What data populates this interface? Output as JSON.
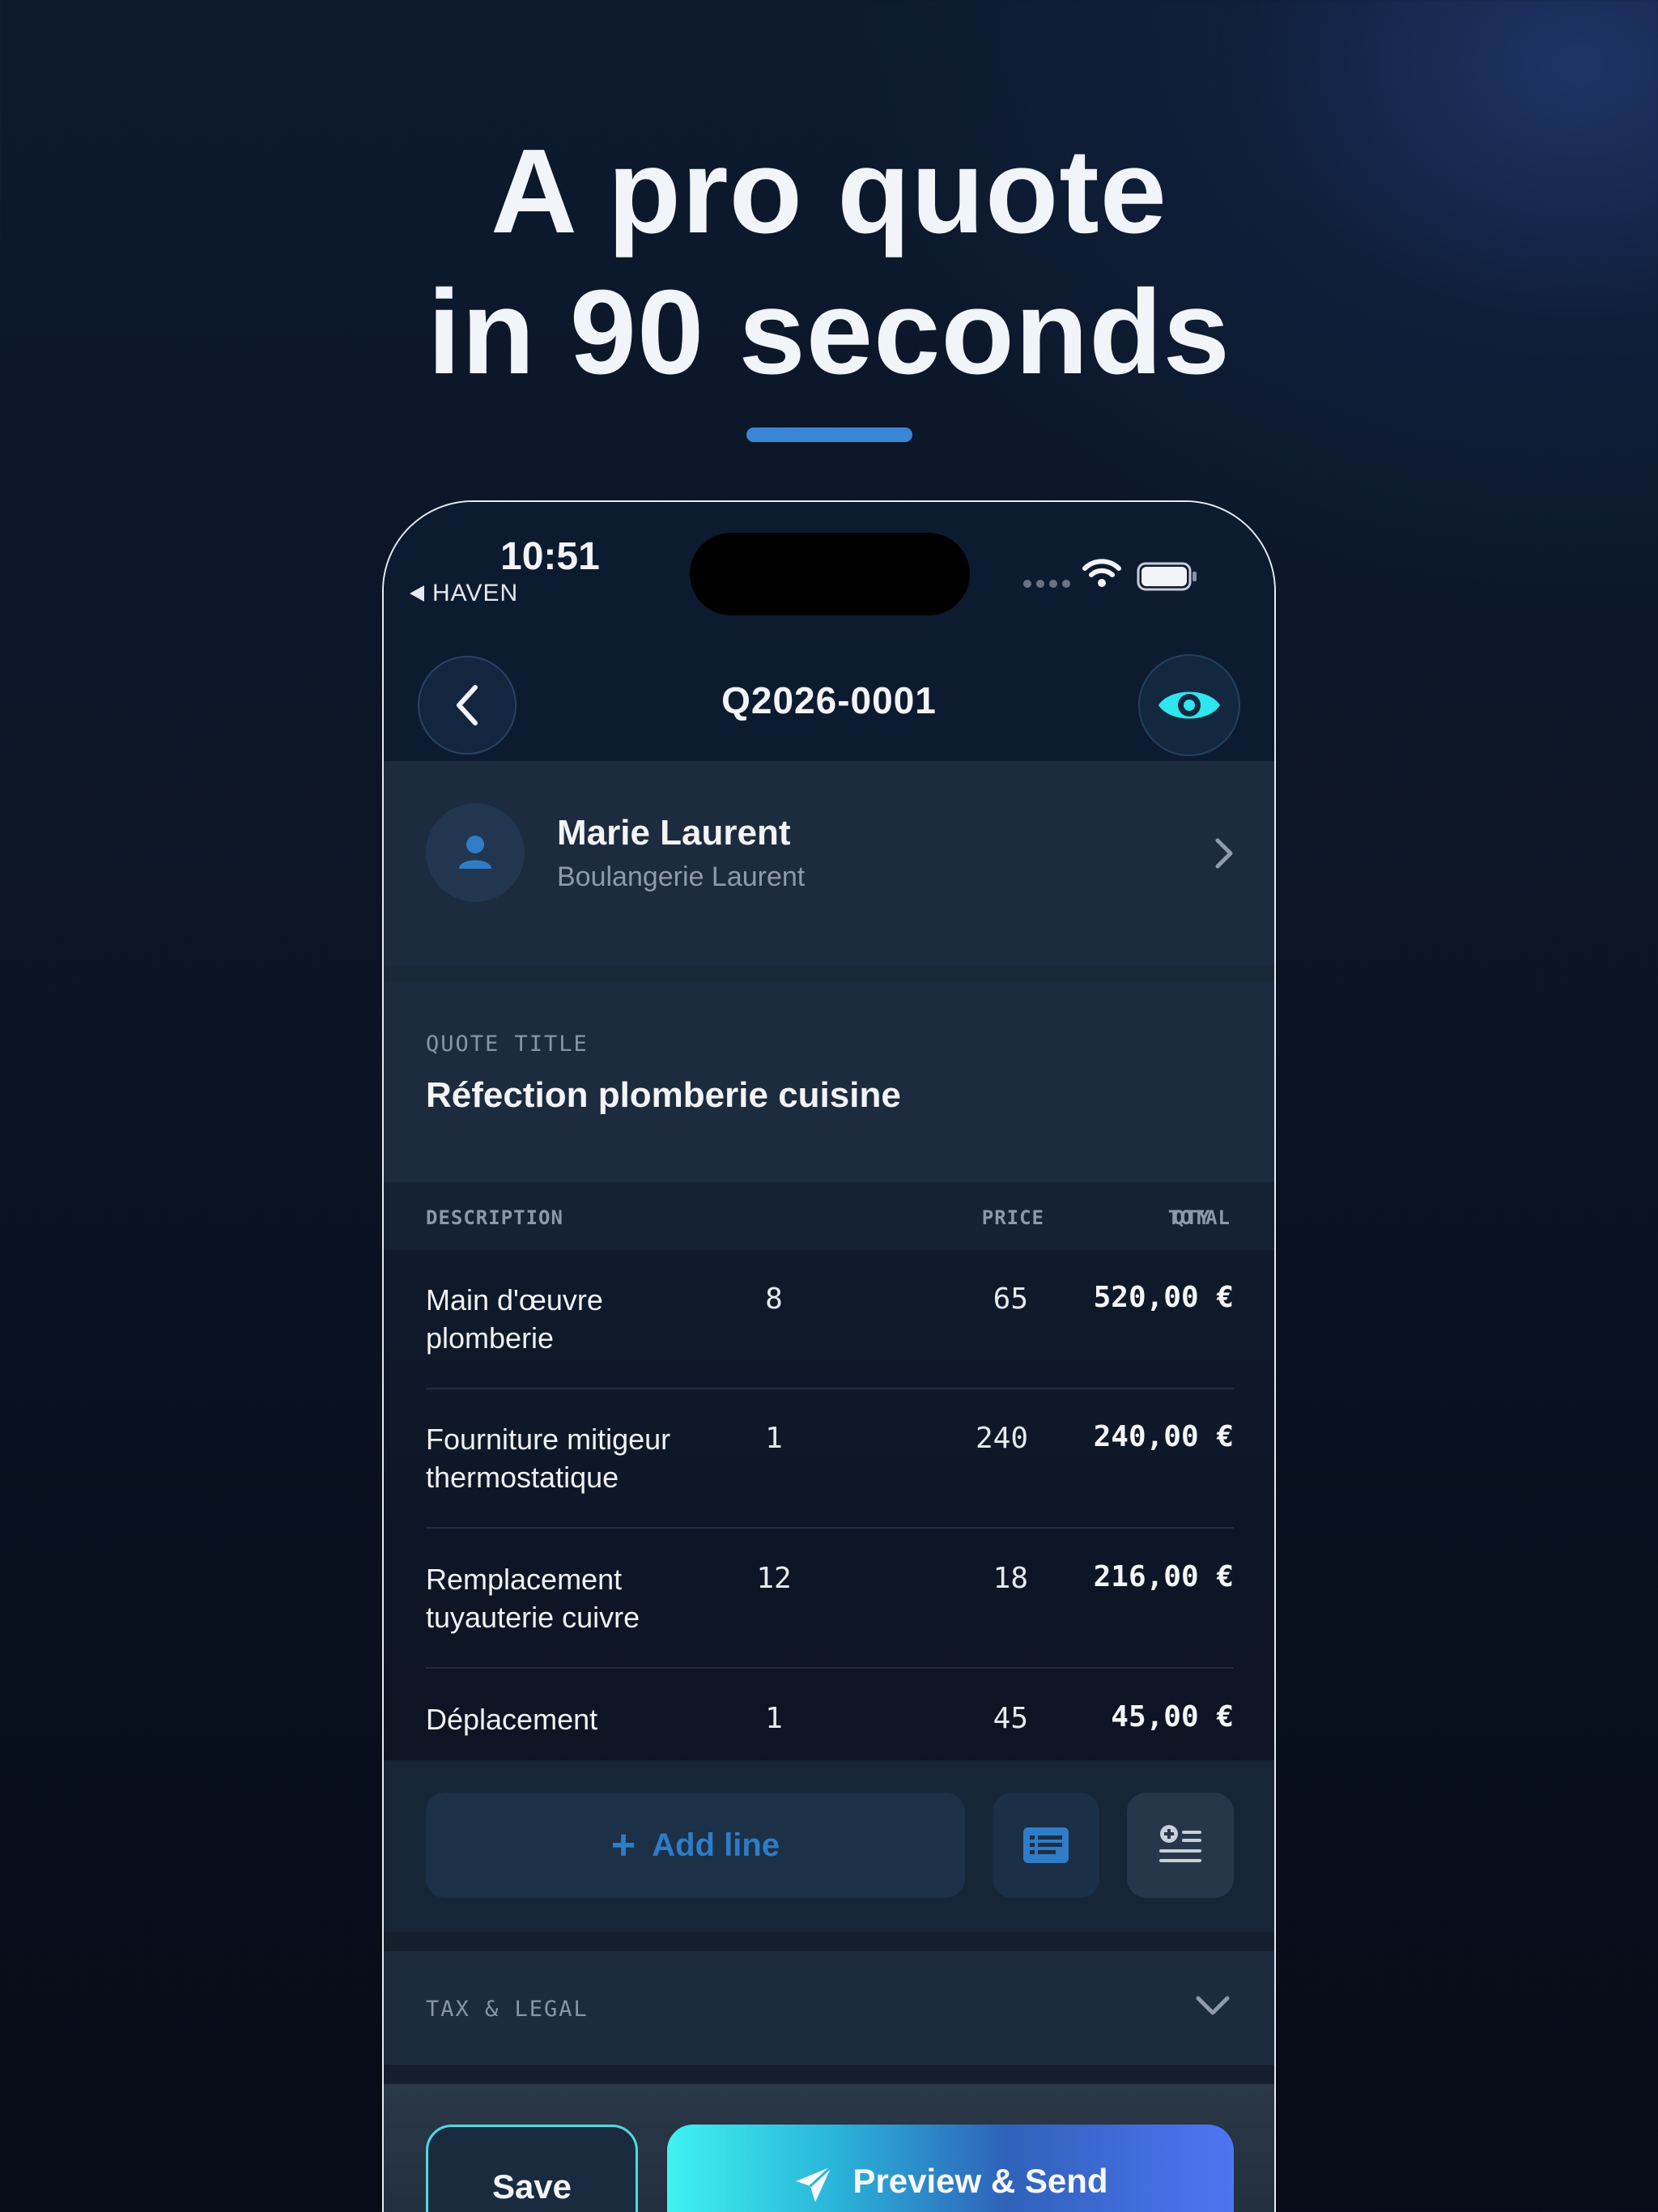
{
  "headline": {
    "line1": "A pro quote",
    "line2": "in 90 seconds"
  },
  "status_bar": {
    "time": "10:51",
    "back_app": "HAVEN"
  },
  "nav": {
    "title": "Q2026-0001"
  },
  "client": {
    "name": "Marie Laurent",
    "company": "Boulangerie Laurent"
  },
  "quote_title": {
    "label": "QUOTE TITLE",
    "value": "Réfection plomberie cuisine"
  },
  "table": {
    "headers": {
      "description": "DESCRIPTION",
      "qty": "QTY",
      "price": "PRICE",
      "total": "TOTAL"
    },
    "rows": [
      {
        "description": "Main d'œuvre plomberie",
        "qty": "8",
        "price": "65",
        "total": "520,00 €"
      },
      {
        "description": "Fourniture mitigeur thermostatique",
        "qty": "1",
        "price": "240",
        "total": "240,00 €"
      },
      {
        "description": "Remplacement tuyauterie cuivre",
        "qty": "12",
        "price": "18",
        "total": "216,00 €"
      },
      {
        "description": "Déplacement",
        "qty": "1",
        "price": "45",
        "total": "45,00 €"
      }
    ]
  },
  "actions": {
    "add_line": "Add line"
  },
  "tax_section": {
    "label": "TAX & LEGAL"
  },
  "footer": {
    "save": "Save",
    "preview_send": "Preview & Send"
  },
  "colors": {
    "accent": "#2f7cc7",
    "cyan": "#3ff3f0",
    "background": "#0a1424"
  }
}
